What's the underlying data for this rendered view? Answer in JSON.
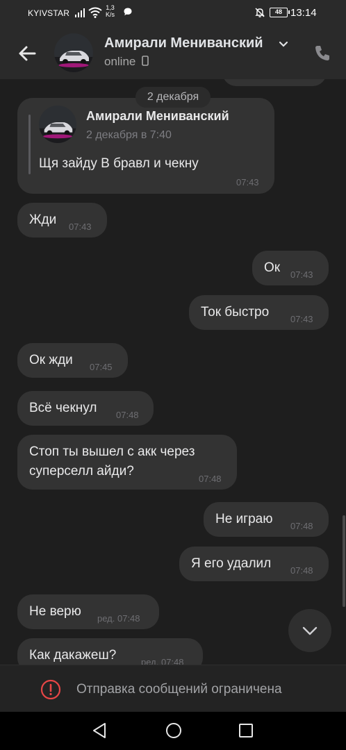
{
  "status_bar": {
    "carrier": "KYIVSTAR",
    "speed_top": "1,3",
    "speed_bottom": "K/s",
    "battery": "48",
    "time": "13:14"
  },
  "header": {
    "name": "Амирали Мениванский",
    "status": "online"
  },
  "date_separator": "2 декабря",
  "quote": {
    "author": "Амирали Мениванский",
    "date": "2 декабря в 7:40",
    "text": "Щя зайду В бравл и чекну",
    "time": "07:43"
  },
  "messages": [
    {
      "text": "Жди",
      "time": "07:43",
      "side": "in"
    },
    {
      "text": "Ок",
      "time": "07:43",
      "side": "out"
    },
    {
      "text": "Ток быстро",
      "time": "07:43",
      "side": "out"
    },
    {
      "text": "Ок жди",
      "time": "07:45",
      "side": "in"
    },
    {
      "text": "Всё чекнул",
      "time": "07:48",
      "side": "in"
    },
    {
      "line1": "Стоп ты вышел с акк через",
      "line2": "суперселл айди?",
      "time": "07:48",
      "side": "in"
    },
    {
      "text": "Не играю",
      "time": "07:48",
      "side": "out"
    },
    {
      "text": "Я его удалил",
      "time": "07:48",
      "side": "out"
    },
    {
      "text": "Не верю",
      "time": "ред. 07:48",
      "side": "in"
    },
    {
      "text": "Как дакажеш?",
      "time": "ред. 07:48",
      "side": "in"
    }
  ],
  "restriction_text": "Отправка сообщений ограничена",
  "colors": {
    "background": "#1e1e1e",
    "bubble": "#333333",
    "header": "#2a2a2a",
    "warning": "#e64646"
  }
}
